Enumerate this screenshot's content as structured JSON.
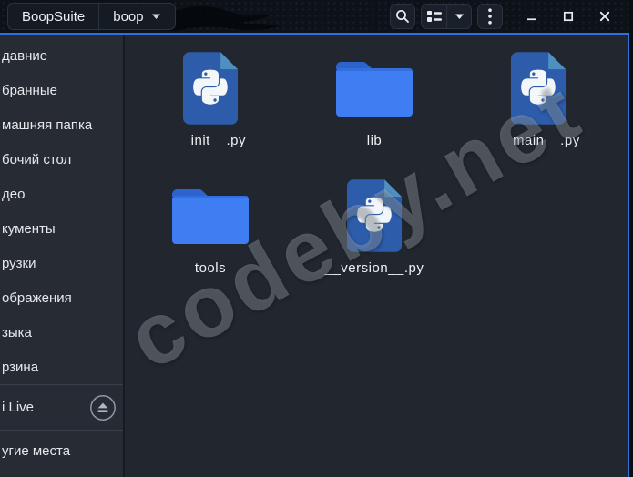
{
  "titlebar": {
    "breadcrumbs": [
      {
        "label": "BoopSuite"
      },
      {
        "label": "boop"
      }
    ],
    "icons": {
      "search": "magnifier",
      "view_toggle": "list-view",
      "view_caret": "chevron-down",
      "menu": "kebab-vertical",
      "minimize": "dash",
      "maximize": "square-outline",
      "close": "cross"
    }
  },
  "sidebar": {
    "items": [
      "давние",
      "бранные",
      "машняя папка",
      "бочий стол",
      "део",
      "кументы",
      "рузки",
      "ображения",
      "зыка",
      "рзина"
    ],
    "device": {
      "label": "i Live",
      "icon": "eject"
    },
    "other_locations": "угие места"
  },
  "files": [
    {
      "name": "__init__.py",
      "icon": "python-file"
    },
    {
      "name": "lib",
      "icon": "folder"
    },
    {
      "name": "__main__.py",
      "icon": "python-file"
    },
    {
      "name": "tools",
      "icon": "folder"
    },
    {
      "name": "__version__.py",
      "icon": "python-file"
    }
  ],
  "watermark": "codeby.net",
  "colors": {
    "accent_blue": "#2d72da",
    "folder_blue": "#3e7df2",
    "python_body_blue": "#2c5caa",
    "python_fold_blue": "#4e90c2",
    "titlebar_bg": "#0d1118",
    "sidebar_bg": "#272c34",
    "content_bg": "#22262e"
  }
}
